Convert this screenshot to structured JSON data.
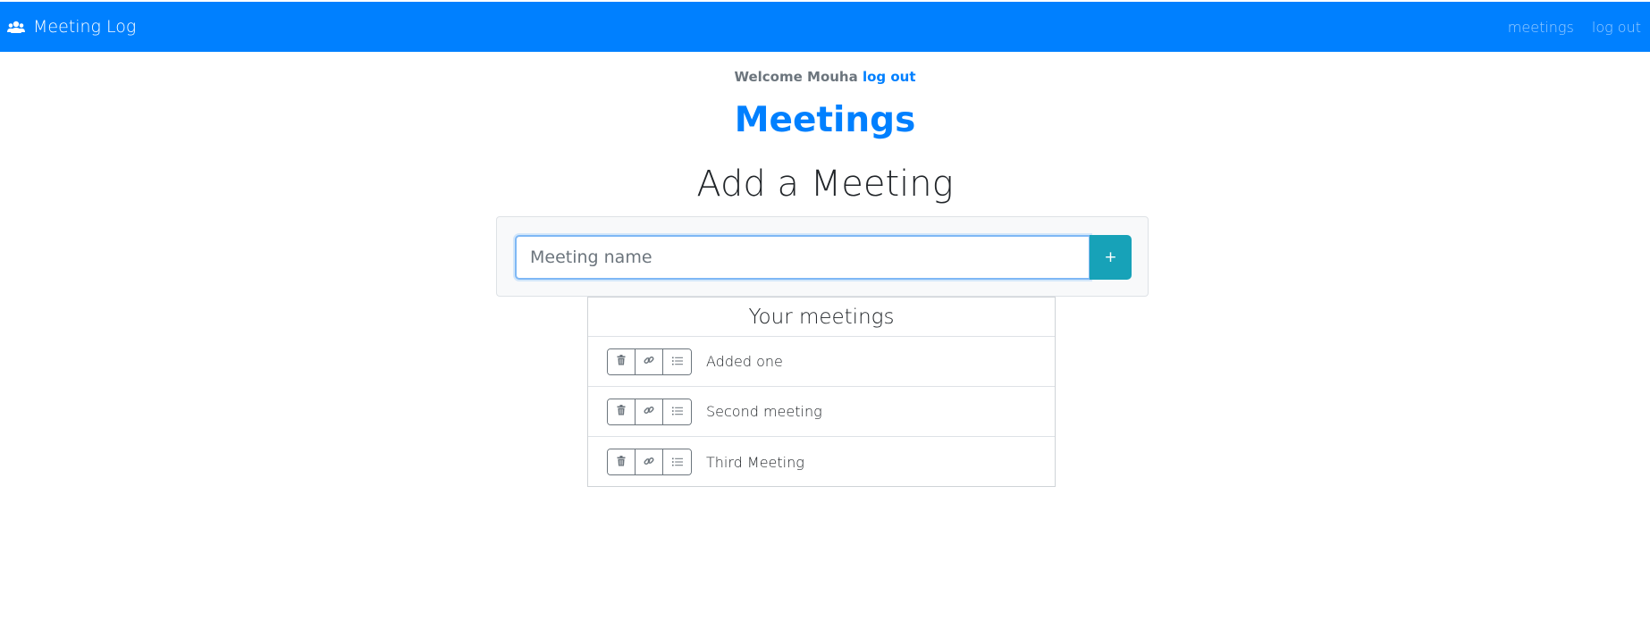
{
  "navbar": {
    "brand_icon": "users-icon",
    "brand": "Meeting Log",
    "links": [
      "meetings",
      "log out"
    ],
    "background": "#0080ff"
  },
  "welcome": {
    "text": "Welcome Mouha",
    "logout_link": "log out"
  },
  "page": {
    "title": "Meetings",
    "add_title": "Add a Meeting"
  },
  "add_form": {
    "placeholder": "Meeting name",
    "value": "",
    "button_label": "+"
  },
  "meetings": {
    "header": "Your meetings",
    "action_icons": [
      "trash-icon",
      "link-icon",
      "list-icon"
    ],
    "items": [
      {
        "name": "Added one"
      },
      {
        "name": "Second meeting"
      },
      {
        "name": "Third Meeting"
      }
    ]
  },
  "colors": {
    "primary": "#0080ff",
    "add_button": "#17a2b8",
    "muted": "#6c757d"
  }
}
